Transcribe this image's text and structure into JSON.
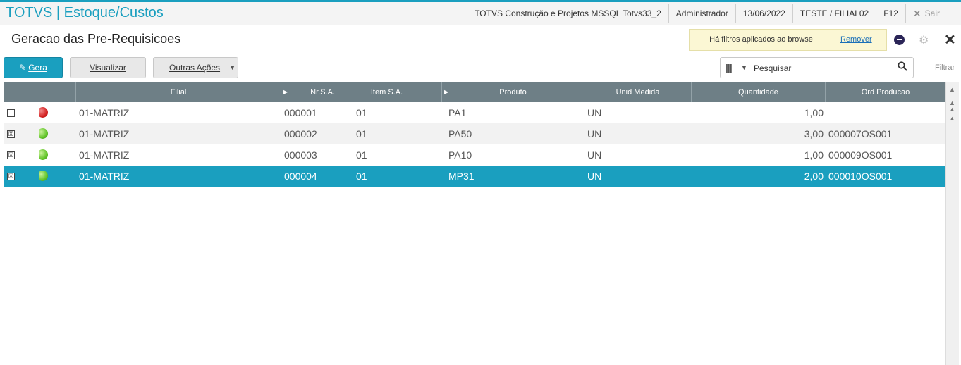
{
  "app": {
    "title": "TOTVS | Estoque/Custos",
    "environment": "TOTVS Construção e Projetos MSSQL Totvs33_2",
    "user": "Administrador",
    "date": "13/06/2022",
    "branch": "TESTE / FILIAL02",
    "shortcut": "F12",
    "exit_label": "Sair"
  },
  "page": {
    "title": "Geracao das Pre-Requisicoes",
    "filter_message": "Há filtros aplicados ao browse",
    "filter_remove": "Remover"
  },
  "toolbar": {
    "gera_label": "Gera",
    "visualizar_label": "Visualizar",
    "outras_label": "Outras Ações",
    "search_value": "Pesquisar",
    "filtrar_label": "Filtrar"
  },
  "grid": {
    "columns": [
      "",
      "",
      "Filial",
      "Nr.S.A.",
      "Item S.A.",
      "Produto",
      "Unid Medida",
      "Quantidade",
      "Ord Producao"
    ],
    "rows": [
      {
        "checked": "",
        "status": "red",
        "filial": "01-MATRIZ",
        "nr": "000001",
        "item": "01",
        "produto": "PA1",
        "un": "UN",
        "qtd": "1,00",
        "ord": ""
      },
      {
        "checked": "☒",
        "status": "green",
        "filial": "01-MATRIZ",
        "nr": "000002",
        "item": "01",
        "produto": "PA50",
        "un": "UN",
        "qtd": "3,00",
        "ord": "000007OS001"
      },
      {
        "checked": "☒",
        "status": "green",
        "filial": "01-MATRIZ",
        "nr": "000003",
        "item": "01",
        "produto": "PA10",
        "un": "UN",
        "qtd": "1,00",
        "ord": "000009OS001"
      },
      {
        "checked": "☒",
        "status": "green",
        "filial": "01-MATRIZ",
        "nr": "000004",
        "item": "01",
        "produto": "MP31",
        "un": "UN",
        "qtd": "2,00",
        "ord": "000010OS001"
      }
    ]
  },
  "colors": {
    "accent": "#1a9fbf",
    "header_bg": "#6e7f86",
    "filter_bg": "#fbf7d4"
  }
}
